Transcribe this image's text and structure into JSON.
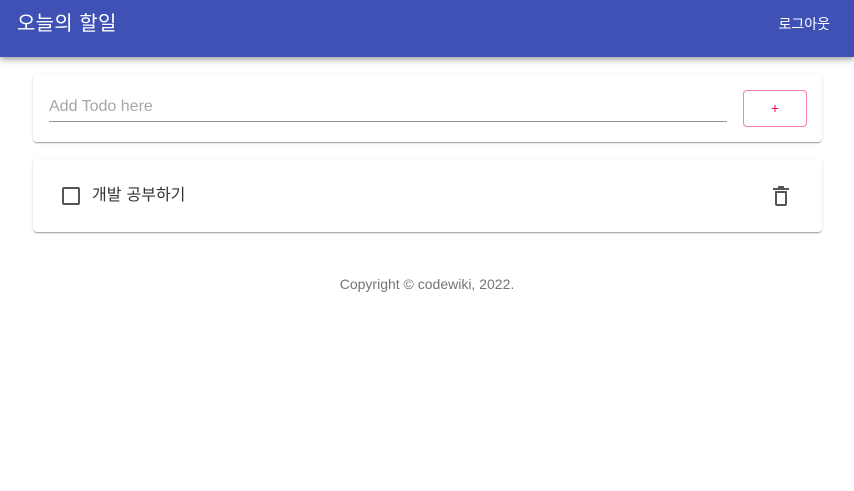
{
  "header": {
    "title": "오늘의 할일",
    "logout_label": "로그아웃",
    "color": "#3f51b5"
  },
  "add_todo": {
    "placeholder": "Add Todo here",
    "value": "",
    "button_label": "+",
    "accent_color": "#f50057"
  },
  "todos": [
    {
      "title": "개발 공부하기",
      "done": false,
      "delete_icon": "trash-icon"
    }
  ],
  "footer": {
    "copyright": "Copyright © codewiki, 2022."
  }
}
